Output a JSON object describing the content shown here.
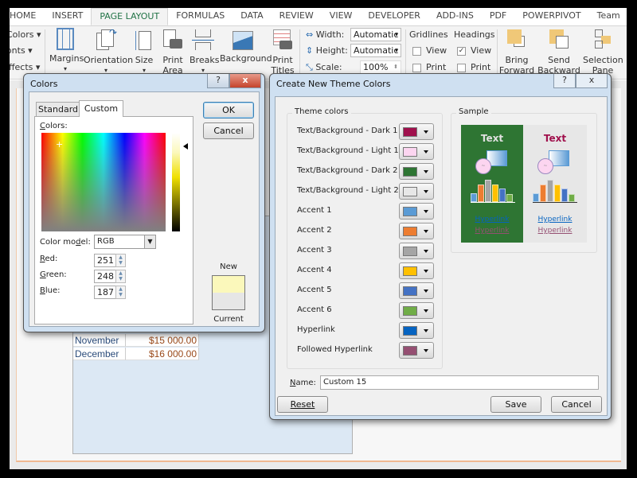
{
  "ribbon": {
    "tabs": [
      "HOME",
      "INSERT",
      "PAGE LAYOUT",
      "FORMULAS",
      "DATA",
      "REVIEW",
      "VIEW",
      "DEVELOPER",
      "ADD-INS",
      "PDF",
      "POWERPIVOT",
      "Team"
    ],
    "active_tab": "PAGE LAYOUT",
    "themes": {
      "colors": "Colors",
      "fonts": "Fonts",
      "effects": "Effects"
    },
    "page_setup": {
      "margins": "Margins",
      "orientation": "Orientation",
      "size": "Size",
      "print_area_1": "Print",
      "print_area_2": "Area",
      "breaks": "Breaks",
      "background": "Background",
      "print_titles_1": "Print",
      "print_titles_2": "Titles"
    },
    "scale_to_fit": {
      "width_label": "Width:",
      "width_value": "Automatic",
      "height_label": "Height:",
      "height_value": "Automatic",
      "scale_label": "Scale:",
      "scale_value": "100%"
    },
    "sheet_options": {
      "gridlines": "Gridlines",
      "headings": "Headings",
      "view": "View",
      "print": "Print",
      "gridlines_view_checked": false,
      "gridlines_print_checked": false,
      "headings_view_checked": true,
      "headings_print_checked": false
    },
    "arrange": {
      "bring_forward_1": "Bring",
      "bring_forward_2": "Forward",
      "send_backward_1": "Send",
      "send_backward_2": "Backward",
      "selection_pane_1": "Selection",
      "selection_pane_2": "Pane"
    }
  },
  "sheet": {
    "rows": [
      {
        "month": "November",
        "amount": "$15 000.00"
      },
      {
        "month": "December",
        "amount": "$16 000.00"
      }
    ]
  },
  "colors_dialog": {
    "title": "Colors",
    "help": "?",
    "close": "x",
    "tabs": [
      "Standard",
      "Custom"
    ],
    "active_tab": "Custom",
    "colors_label": "Colors:",
    "color_model_label": "Color model:",
    "color_model_value": "RGB",
    "red_label": "Red:",
    "red_value": "251",
    "green_label": "Green:",
    "green_value": "248",
    "blue_label": "Blue:",
    "blue_value": "187",
    "ok": "OK",
    "cancel": "Cancel",
    "new_label": "New",
    "current_label": "Current",
    "new_color": "#fbf8bb",
    "current_color": "#e6e6e6"
  },
  "theme_dialog": {
    "title": "Create New Theme Colors",
    "help": "?",
    "close": "x",
    "theme_colors_label": "Theme colors",
    "sample_label": "Sample",
    "items": [
      {
        "label": "Text/Background - Dark 1",
        "color": "#a0104c"
      },
      {
        "label": "Text/Background - Light 1",
        "color": "#fcd5f0"
      },
      {
        "label": "Text/Background - Dark 2",
        "color": "#2e7533"
      },
      {
        "label": "Text/Background - Light 2",
        "color": "#e7e7e7"
      },
      {
        "label": "Accent 1",
        "color": "#5b9bd5"
      },
      {
        "label": "Accent 2",
        "color": "#ed7d31"
      },
      {
        "label": "Accent 3",
        "color": "#a5a5a5"
      },
      {
        "label": "Accent 4",
        "color": "#ffc000"
      },
      {
        "label": "Accent 5",
        "color": "#4472c4"
      },
      {
        "label": "Accent 6",
        "color": "#70ad47"
      },
      {
        "label": "Hyperlink",
        "color": "#0563c1"
      },
      {
        "label": "Followed Hyperlink",
        "color": "#954f72"
      }
    ],
    "sample": {
      "text": "Text",
      "hyperlink": "Hyperlink",
      "followed_hyperlink": "Hyperlink"
    },
    "name_label": "Name:",
    "name_value": "Custom 15",
    "reset": "Reset",
    "save": "Save",
    "cancel": "Cancel"
  }
}
